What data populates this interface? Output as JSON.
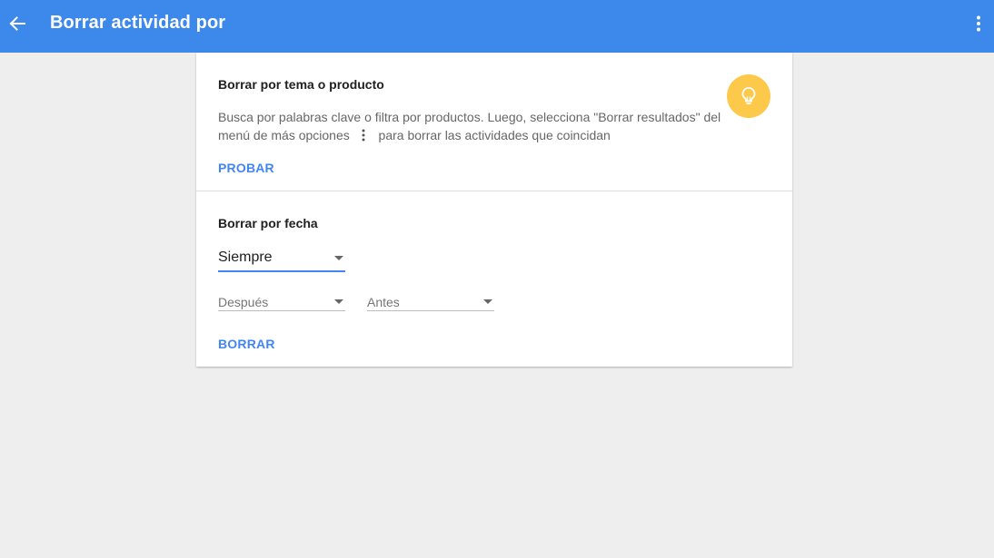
{
  "header": {
    "title": "Borrar actividad por",
    "back_icon": "arrow-back-icon",
    "more_icon": "more-vert-icon",
    "background_color": "#3d88eb"
  },
  "topic_section": {
    "heading": "Borrar por tema o producto",
    "description_before_icon": "Busca por palabras clave o filtra por productos. Luego, selecciona \"Borrar resultados\" del menú de más opciones",
    "inline_icon": "more-vert-icon",
    "description_after_icon": "para borrar las actividades que coincidan",
    "action_label": "PROBAR",
    "tip_icon": "lightbulb-icon",
    "tip_icon_color": "#fdc94a"
  },
  "date_section": {
    "heading": "Borrar por fecha",
    "range_select": {
      "value": "Siempre"
    },
    "after_select": {
      "placeholder": "Después"
    },
    "before_select": {
      "placeholder": "Antes"
    },
    "action_label": "BORRAR"
  },
  "accent_color": "#4285f4"
}
